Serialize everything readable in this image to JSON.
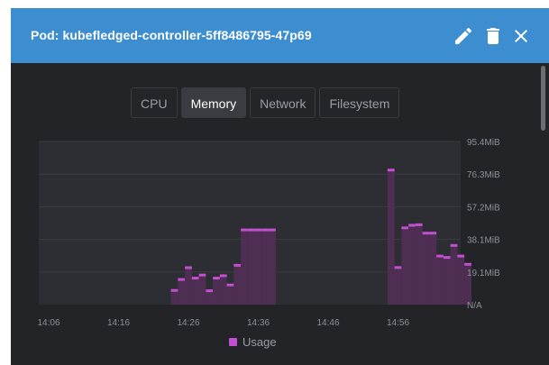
{
  "dialog": {
    "title": "Pod: kubefledged-controller-5ff8486795-47p69",
    "icons": [
      "pencil-icon",
      "trash-icon",
      "close-icon"
    ]
  },
  "tabs": [
    {
      "label": "CPU",
      "active": false
    },
    {
      "label": "Memory",
      "active": true
    },
    {
      "label": "Network",
      "active": false
    },
    {
      "label": "Filesystem",
      "active": false
    }
  ],
  "chart_data": {
    "type": "bar",
    "y_ticks": [
      "N/A",
      "19.1MiB",
      "38.1MiB",
      "57.2MiB",
      "76.3MiB",
      "95.4MiB"
    ],
    "x_ticks": [
      "14:06",
      "14:16",
      "14:26",
      "14:36",
      "14:46",
      "14:56"
    ],
    "ylim": [
      0,
      95.4
    ],
    "y_unit": "MiB",
    "series": [
      {
        "name": "Usage",
        "color": "#c44fd3",
        "x": [
          "14:24",
          "14:25",
          "14:26",
          "14:27",
          "14:28",
          "14:29",
          "14:30",
          "14:31",
          "14:32",
          "14:33",
          "14:34",
          "14:35",
          "14:36",
          "14:37",
          "14:38",
          "14:39",
          "14:40",
          "14:41",
          "14:42",
          "14:43",
          "14:44",
          "14:45",
          "14:46",
          "14:47",
          "14:48",
          "14:49",
          "14:50",
          "14:51",
          "14:52",
          "14:53",
          "14:54",
          "14:55",
          "14:56",
          "14:57",
          "14:58",
          "14:59",
          "15:00",
          "15:01",
          "15:02",
          "15:03",
          "15:04",
          "15:05",
          "15:06"
        ],
        "values": [
          8.3,
          14.7,
          21.6,
          15.5,
          17.3,
          8.1,
          15.5,
          16.9,
          11.5,
          23,
          43.7,
          43.7,
          43.7,
          43.7,
          43.7,
          null,
          null,
          null,
          null,
          null,
          null,
          null,
          null,
          null,
          null,
          null,
          null,
          null,
          null,
          null,
          null,
          78.7,
          21.7,
          44.9,
          46.4,
          46.7,
          41.8,
          41.8,
          28.4,
          27.6,
          34.6,
          28.4,
          23.6
        ]
      }
    ],
    "legend": "bottom",
    "grid": true
  }
}
